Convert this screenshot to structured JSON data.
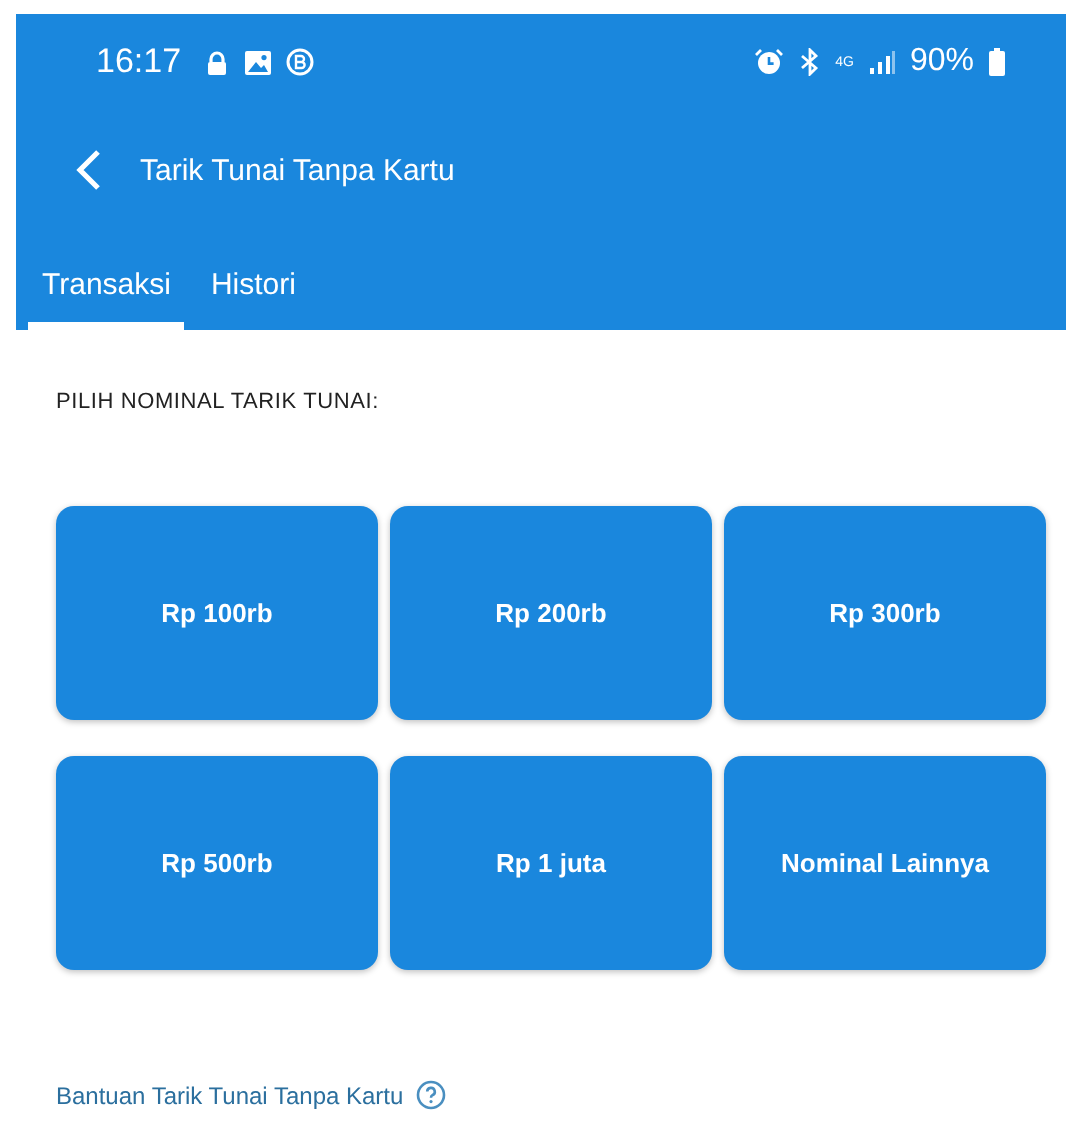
{
  "status_bar": {
    "time": "16:17",
    "network": "4G",
    "battery": "90%"
  },
  "header": {
    "title": "Tarik Tunai Tanpa Kartu"
  },
  "tabs": [
    {
      "label": "Transaksi",
      "selected": true
    },
    {
      "label": "Histori",
      "selected": false
    }
  ],
  "section_label": "PILIH NOMINAL TARIK TUNAI:",
  "amounts": [
    "Rp 100rb",
    "Rp 200rb",
    "Rp 300rb",
    "Rp 500rb",
    "Rp 1 juta",
    "Nominal Lainnya"
  ],
  "help_link": "Bantuan Tarik Tunai Tanpa Kartu"
}
